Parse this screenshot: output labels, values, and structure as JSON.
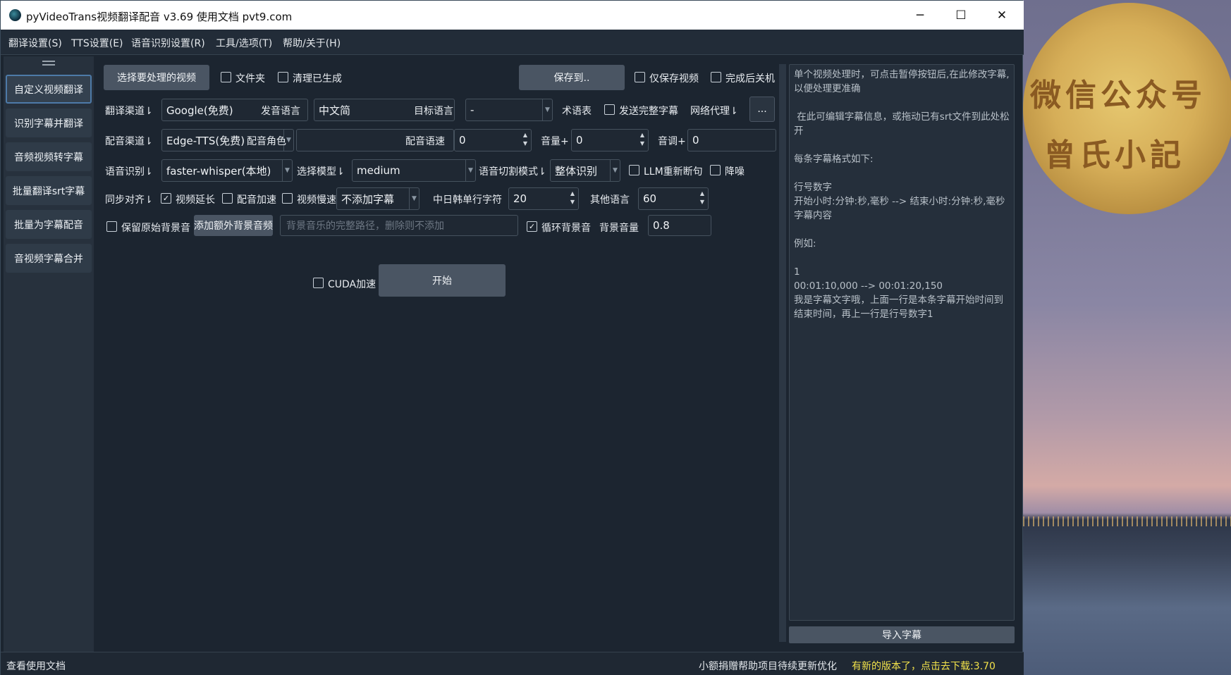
{
  "window": {
    "title": "pyVideoTrans视频翻译配音 v3.69  使用文档  pvt9.com",
    "minimize": "─",
    "maximize": "☐",
    "close": "✕"
  },
  "menu": [
    "翻译设置(S)",
    "TTS设置(E)",
    "语音识别设置(R)",
    "工具/选项(T)",
    "帮助/关于(H)"
  ],
  "sidebar": {
    "items": [
      {
        "label": "自定义视频翻译",
        "active": true
      },
      {
        "label": "识别字幕并翻译",
        "active": false
      },
      {
        "label": "音频视频转字幕",
        "active": false
      },
      {
        "label": "批量翻译srt字幕",
        "active": false
      },
      {
        "label": "批量为字幕配音",
        "active": false
      },
      {
        "label": "音视频字幕合并",
        "active": false
      }
    ]
  },
  "row1": {
    "select_video": "选择要处理的视频",
    "folder": "文件夹",
    "clear_generated": "清理已生成",
    "save_to": "保存到..",
    "only_save_video": "仅保存视频",
    "shutdown_after": "完成后关机"
  },
  "row2": {
    "translate_channel_label": "翻译渠道⇂",
    "translate_channel_value": "Google(免费)",
    "source_lang_label": "发音语言",
    "source_lang_value": "中文简",
    "target_lang_label": "目标语言",
    "target_lang_value": "-",
    "glossary": "术语表",
    "send_full_subtitle": "发送完整字幕",
    "proxy_label": "网络代理⇂",
    "proxy_button": "..."
  },
  "row3": {
    "dub_channel_label": "配音渠道⇂",
    "dub_channel_value": "Edge-TTS(免费)",
    "dub_role_label": "配音角色",
    "dub_role_value": "",
    "dub_speed_label": "配音语速",
    "dub_speed_value": "0",
    "volume_label": "音量+",
    "volume_value": "0",
    "pitch_label": "音调+",
    "pitch_value": "0"
  },
  "row4": {
    "asr_label": "语音识别⇂",
    "asr_value": "faster-whisper(本地)",
    "model_label": "选择模型⇂",
    "model_value": "medium",
    "split_mode_label": "语音切割模式⇂",
    "split_mode_value": "整体识别",
    "llm_resegment": "LLM重新断句",
    "denoise": "降噪"
  },
  "row5": {
    "sync_label": "同步对齐⇂",
    "video_extend": "视频延长",
    "dub_speedup": "配音加速",
    "video_slowdown": "视频慢速",
    "subtitle_mode_value": "不添加字幕",
    "cjk_line_chars_label": "中日韩单行字符",
    "cjk_line_chars_value": "20",
    "other_lang_label": "其他语言",
    "other_lang_value": "60"
  },
  "row6": {
    "keep_original_bg": "保留原始背景音",
    "add_bg_audio": "添加额外背景音频",
    "bg_path_placeholder": "背景音乐的完整路径，删除则不添加",
    "loop_bg": "循环背景音",
    "bg_volume_label": "背景音量",
    "bg_volume_value": "0.8"
  },
  "run": {
    "cuda": "CUDA加速",
    "start": "开始"
  },
  "checks": {
    "folder": false,
    "clear_generated": false,
    "only_save_video": false,
    "shutdown_after": false,
    "send_full_subtitle": false,
    "llm_resegment": false,
    "denoise": false,
    "video_extend": true,
    "dub_speedup": false,
    "video_slowdown": false,
    "keep_original_bg": false,
    "loop_bg": true,
    "cuda": false
  },
  "subtitle_panel": {
    "text": "单个视频处理时，可点击暂停按钮后,在此修改字幕,以便处理更准确\n\n 在此可编辑字幕信息，或拖动已有srt文件到此处松开\n\n每条字幕格式如下:\n\n行号数字\n开始小时:分钟:秒,毫秒 --> 结束小时:分钟:秒,毫秒\n字幕内容\n\n例如:\n\n1\n00:01:10,000 --> 00:01:20,150\n我是字幕文字哦，上面一行是本条字幕开始时间到结束时间，再上一行是行号数字1",
    "import_button": "导入字幕"
  },
  "status": {
    "docs_link": "查看使用文档",
    "donate": "小额捐赠帮助项目待续更新优化",
    "update": "有新的版本了，点击去下载:3.70"
  },
  "wallpaper": {
    "moon_text_line1": "微信公众号",
    "moon_text_line2": "曾氏小記"
  },
  "colors": {
    "accent_border": "#4d7aa8",
    "update_text": "#f2e24a",
    "background": "#1c2530"
  }
}
